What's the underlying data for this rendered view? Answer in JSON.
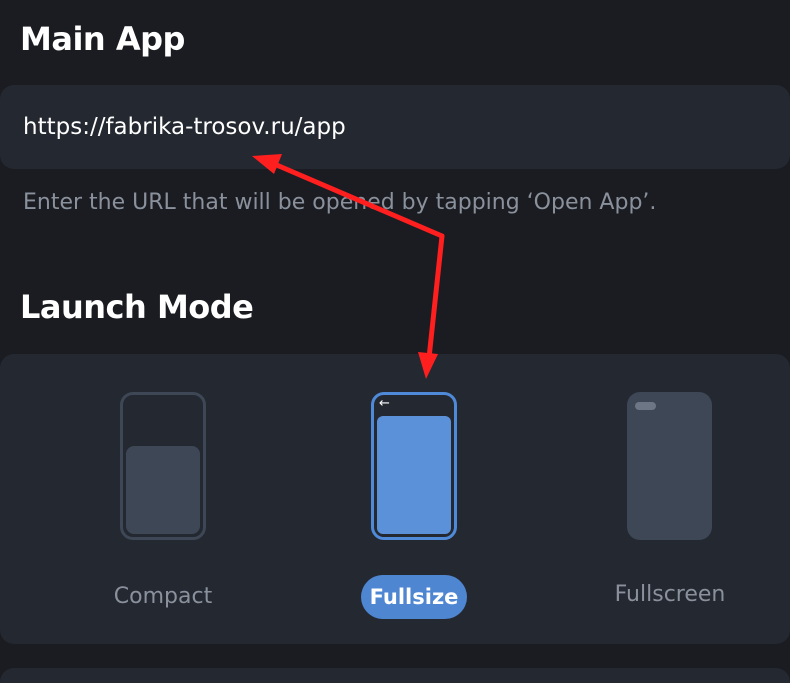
{
  "main_app": {
    "title": "Main App",
    "url_value": "https://fabrika-trosov.ru/app",
    "hint": "Enter the URL that will be opened by tapping ‘Open App’."
  },
  "launch_mode": {
    "title": "Launch Mode",
    "selected": "Fullsize",
    "options": [
      {
        "label": "Compact",
        "icon": "phone-compact-icon"
      },
      {
        "label": "Fullsize",
        "icon": "phone-fullsize-icon"
      },
      {
        "label": "Fullscreen",
        "icon": "phone-fullscreen-icon"
      }
    ]
  },
  "colors": {
    "background": "#1a1c21",
    "card": "#242831",
    "accent": "#4f86d2",
    "muted_text": "#8a919c",
    "annotation_arrow": "#ff1f1f"
  }
}
